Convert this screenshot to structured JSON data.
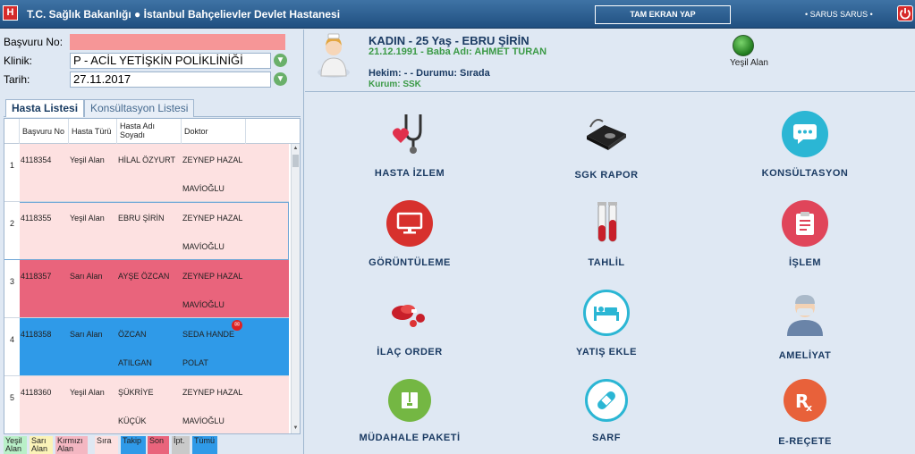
{
  "titlebar": {
    "logo": "H",
    "title": "T.C. Sağlık Bakanlığı ● İstanbul Bahçelievler Devlet Hastanesi",
    "fullscreen_label": "TAM EKRAN YAP",
    "user": "• SARUS SARUS •"
  },
  "form": {
    "basvuru_label": "Başvuru No:",
    "basvuru_value": "",
    "klinik_label": "Klinik:",
    "klinik_value": "P - ACİL YETİŞKİN POLİKLİNİĞİ",
    "tarih_label": "Tarih:",
    "tarih_value": "27.11.2017"
  },
  "tabs": [
    "Hasta Listesi",
    "Konsültasyon Listesi"
  ],
  "list": {
    "headers": [
      "Başvuru No",
      "Hasta Türü",
      "Hasta Adı\nSoyadı",
      "Doktor"
    ],
    "rows": [
      {
        "idx": "1",
        "no": "4118354",
        "tur": "Yeşil Alan",
        "ad1": "HİLAL ÖZYURT",
        "ad2": "",
        "dr1": "ZEYNEP HAZAL",
        "dr2": "MAVİOĞLU",
        "bg": "#fde1e1"
      },
      {
        "idx": "2",
        "no": "4118355",
        "tur": "Yeşil Alan",
        "ad1": "EBRU ŞİRİN",
        "ad2": "",
        "dr1": "ZEYNEP HAZAL",
        "dr2": "MAVİOĞLU",
        "bg": "#fde1e1"
      },
      {
        "idx": "3",
        "no": "4118357",
        "tur": "Sarı Alan",
        "ad1": "AYŞE ÖZCAN",
        "ad2": "",
        "dr1": "ZEYNEP HAZAL",
        "dr2": "MAVİOĞLU",
        "bg": "#e9647c"
      },
      {
        "idx": "4",
        "no": "4118358",
        "tur": "Sarı Alan",
        "ad1": "ÖZCAN",
        "ad2": "ATILGAN",
        "dr1": "SEDA HANDE",
        "dr2": "POLAT",
        "bg": "#2f9ae8"
      },
      {
        "idx": "5",
        "no": "4118360",
        "tur": "Yeşil Alan",
        "ad1": "ŞÜKRİYE",
        "ad2": "KÜÇÜK",
        "dr1": "ZEYNEP HAZAL",
        "dr2": "MAVİOĞLU",
        "bg": "#fde1e1"
      }
    ]
  },
  "legend": [
    {
      "label": "Yeşil\nAlan",
      "color": "#b9f0c8"
    },
    {
      "label": "Sarı\nAlan",
      "color": "#fbf3b8"
    },
    {
      "label": "Kırmızı\nAlan",
      "color": "#f4b7c2"
    },
    {
      "label": "Sıra",
      "color": "#fde1e1"
    },
    {
      "label": "Takip",
      "color": "#2f9ae8"
    },
    {
      "label": "Son",
      "color": "#e9647c"
    },
    {
      "label": "İpt.",
      "color": "#c9c9c9"
    },
    {
      "label": "Tümü",
      "color": "#2f9ae8"
    }
  ],
  "patient": {
    "line1": "KADIN - 25 Yaş - EBRU ŞİRİN",
    "line2": "21.12.1991 - Baba Adı: AHMET TURAN",
    "line3": "Hekim: - - Durumu: Sırada",
    "line4": "Kurum: SSK",
    "status_label": "Yeşil Alan"
  },
  "tiles": [
    {
      "label": "HASTA İZLEM",
      "icon": "stethoscope-icon"
    },
    {
      "label": "SGK RAPOR",
      "icon": "blood-pressure-icon"
    },
    {
      "label": "KONSÜLTASYON",
      "icon": "chat-icon"
    },
    {
      "label": "GÖRÜNTÜLEME",
      "icon": "monitor-icon"
    },
    {
      "label": "TAHLİL",
      "icon": "test-tube-icon"
    },
    {
      "label": "İŞLEM",
      "icon": "clipboard-icon"
    },
    {
      "label": "İLAÇ ORDER",
      "icon": "pills-icon"
    },
    {
      "label": "YATIŞ EKLE",
      "icon": "hospital-bed-icon"
    },
    {
      "label": "AMELİYAT",
      "icon": "surgeon-icon"
    },
    {
      "label": "MÜDAHALE PAKETİ",
      "icon": "package-icon"
    },
    {
      "label": "SARF",
      "icon": "bandage-icon"
    },
    {
      "label": "E-REÇETE",
      "icon": "prescription-icon"
    }
  ]
}
